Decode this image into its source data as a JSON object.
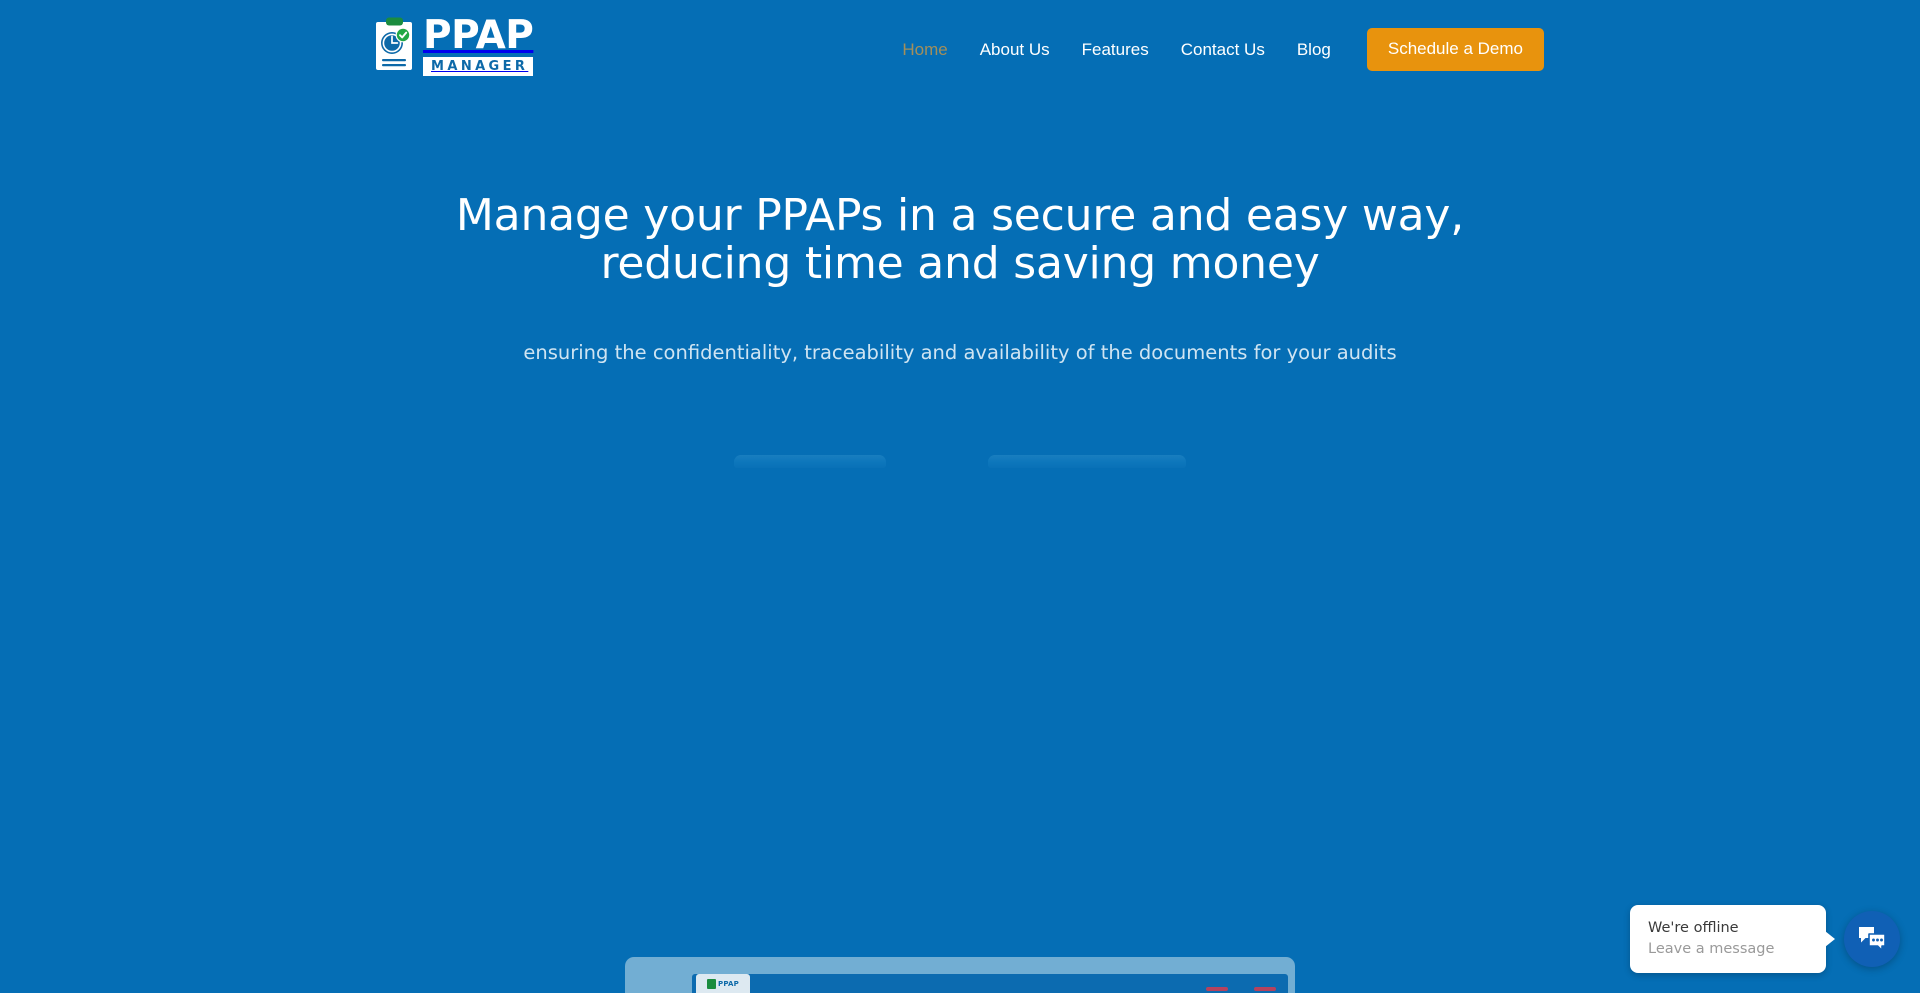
{
  "theme": {
    "background": "#056EB5",
    "accent_orange": "#E8930D",
    "active_nav": "#A38F5B",
    "logo_green": "#1B8C3F",
    "logo_blue": "#0D69A8",
    "chat_blue": "#1060B5"
  },
  "header": {
    "logo": {
      "name": "PPAP",
      "sub": "MANAGER",
      "icon": "clipboard-clock-check-icon"
    },
    "nav": [
      {
        "label": "Home",
        "active": true
      },
      {
        "label": "About Us",
        "active": false
      },
      {
        "label": "Features",
        "active": false
      },
      {
        "label": "Contact Us",
        "active": false
      },
      {
        "label": "Blog",
        "active": false
      }
    ],
    "cta_label": "Schedule a Demo"
  },
  "hero": {
    "title_line_1": "Manage your PPAPs in a secure and easy way,",
    "title_line_2": "reducing time and saving money",
    "subtitle": "ensuring the confidentiality, traceability and availability of the documents for your audits",
    "actions": [
      {
        "name": "primary-action-placeholder",
        "label": ""
      },
      {
        "name": "secondary-action-placeholder",
        "label": ""
      }
    ]
  },
  "app_mockup": {
    "logo_text": "PPAP"
  },
  "chat": {
    "title": "We're offline",
    "subtitle": "Leave a message",
    "launcher_icon": "chat-bubbles-icon"
  }
}
